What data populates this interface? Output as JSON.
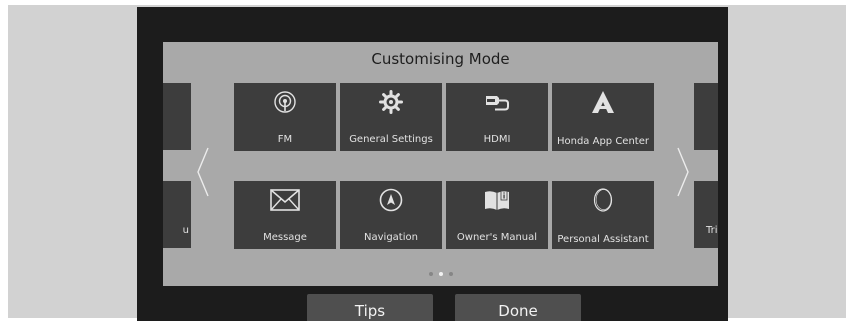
{
  "header": {
    "title": "Customising Mode"
  },
  "tiles": [
    {
      "label": "FM",
      "icon": "radio-icon"
    },
    {
      "label": "General Settings",
      "icon": "gear-icon"
    },
    {
      "label": "HDMI",
      "icon": "hdmi-icon"
    },
    {
      "label": "Honda App Center",
      "icon": "app-center-icon"
    },
    {
      "label": "Message",
      "icon": "envelope-icon"
    },
    {
      "label": "Navigation",
      "icon": "navigation-icon"
    },
    {
      "label": "Owner's Manual",
      "icon": "book-icon"
    },
    {
      "label": "Personal Assistant",
      "icon": "assistant-icon"
    }
  ],
  "partial_tiles": {
    "left_bottom": "u",
    "right_bottom": "Trip"
  },
  "pagination": {
    "pages": 3,
    "active": 2
  },
  "footer": {
    "tips_label": "Tips",
    "done_label": "Done"
  },
  "colors": {
    "panel": "#a9a9a9",
    "tile": "#3d3d3d",
    "screen": "#1c1c1c",
    "button": "#4f4f4f"
  }
}
